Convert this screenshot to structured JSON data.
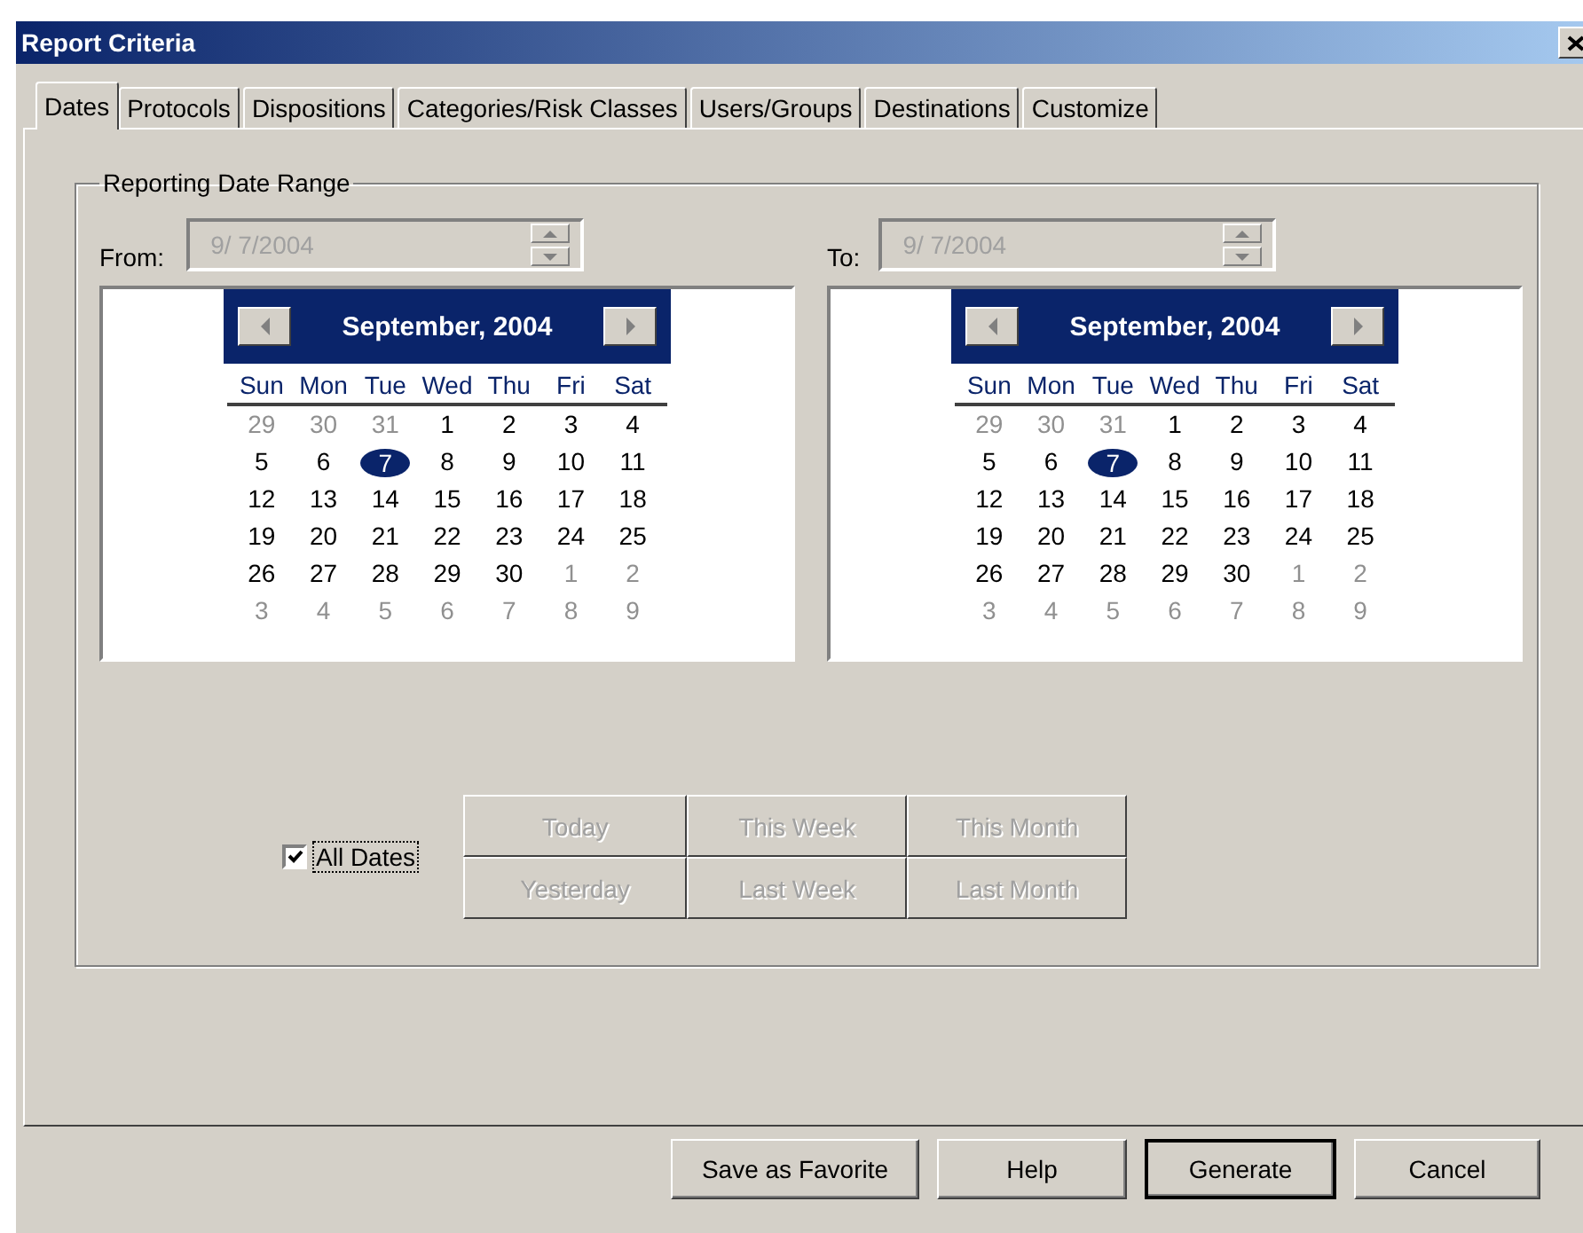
{
  "window": {
    "title": "Report Criteria"
  },
  "tabs": [
    {
      "label": "Dates",
      "selected": true
    },
    {
      "label": "Protocols",
      "selected": false
    },
    {
      "label": "Dispositions",
      "selected": false
    },
    {
      "label": "Categories/Risk Classes",
      "selected": false
    },
    {
      "label": "Users/Groups",
      "selected": false
    },
    {
      "label": "Destinations",
      "selected": false
    },
    {
      "label": "Customize",
      "selected": false
    }
  ],
  "date_range": {
    "title": "Reporting Date Range",
    "pickers": [
      {
        "label": "From:",
        "value": "9/ 7/2004",
        "disabled": true,
        "month": "September, 2004",
        "weekdays": [
          "Sun",
          "Mon",
          "Tue",
          "Wed",
          "Thu",
          "Fri",
          "Sat"
        ],
        "weeks": [
          [
            {
              "day": "29",
              "muted": true,
              "selected": false
            },
            {
              "day": "30",
              "muted": true,
              "selected": false
            },
            {
              "day": "31",
              "muted": true,
              "selected": false
            },
            {
              "day": "1",
              "muted": false,
              "selected": false
            },
            {
              "day": "2",
              "muted": false,
              "selected": false
            },
            {
              "day": "3",
              "muted": false,
              "selected": false
            },
            {
              "day": "4",
              "muted": false,
              "selected": false
            }
          ],
          [
            {
              "day": "5",
              "muted": false,
              "selected": false
            },
            {
              "day": "6",
              "muted": false,
              "selected": false
            },
            {
              "day": "7",
              "muted": false,
              "selected": true
            },
            {
              "day": "8",
              "muted": false,
              "selected": false
            },
            {
              "day": "9",
              "muted": false,
              "selected": false
            },
            {
              "day": "10",
              "muted": false,
              "selected": false
            },
            {
              "day": "11",
              "muted": false,
              "selected": false
            }
          ],
          [
            {
              "day": "12",
              "muted": false,
              "selected": false
            },
            {
              "day": "13",
              "muted": false,
              "selected": false
            },
            {
              "day": "14",
              "muted": false,
              "selected": false
            },
            {
              "day": "15",
              "muted": false,
              "selected": false
            },
            {
              "day": "16",
              "muted": false,
              "selected": false
            },
            {
              "day": "17",
              "muted": false,
              "selected": false
            },
            {
              "day": "18",
              "muted": false,
              "selected": false
            }
          ],
          [
            {
              "day": "19",
              "muted": false,
              "selected": false
            },
            {
              "day": "20",
              "muted": false,
              "selected": false
            },
            {
              "day": "21",
              "muted": false,
              "selected": false
            },
            {
              "day": "22",
              "muted": false,
              "selected": false
            },
            {
              "day": "23",
              "muted": false,
              "selected": false
            },
            {
              "day": "24",
              "muted": false,
              "selected": false
            },
            {
              "day": "25",
              "muted": false,
              "selected": false
            }
          ],
          [
            {
              "day": "26",
              "muted": false,
              "selected": false
            },
            {
              "day": "27",
              "muted": false,
              "selected": false
            },
            {
              "day": "28",
              "muted": false,
              "selected": false
            },
            {
              "day": "29",
              "muted": false,
              "selected": false
            },
            {
              "day": "30",
              "muted": false,
              "selected": false
            },
            {
              "day": "1",
              "muted": true,
              "selected": false
            },
            {
              "day": "2",
              "muted": true,
              "selected": false
            }
          ],
          [
            {
              "day": "3",
              "muted": true,
              "selected": false
            },
            {
              "day": "4",
              "muted": true,
              "selected": false
            },
            {
              "day": "5",
              "muted": true,
              "selected": false
            },
            {
              "day": "6",
              "muted": true,
              "selected": false
            },
            {
              "day": "7",
              "muted": true,
              "selected": false
            },
            {
              "day": "8",
              "muted": true,
              "selected": false
            },
            {
              "day": "9",
              "muted": true,
              "selected": false
            }
          ]
        ]
      },
      {
        "label": "To:",
        "value": "9/ 7/2004",
        "disabled": true,
        "month": "September, 2004",
        "weekdays": [
          "Sun",
          "Mon",
          "Tue",
          "Wed",
          "Thu",
          "Fri",
          "Sat"
        ],
        "weeks": [
          [
            {
              "day": "29",
              "muted": true,
              "selected": false
            },
            {
              "day": "30",
              "muted": true,
              "selected": false
            },
            {
              "day": "31",
              "muted": true,
              "selected": false
            },
            {
              "day": "1",
              "muted": false,
              "selected": false
            },
            {
              "day": "2",
              "muted": false,
              "selected": false
            },
            {
              "day": "3",
              "muted": false,
              "selected": false
            },
            {
              "day": "4",
              "muted": false,
              "selected": false
            }
          ],
          [
            {
              "day": "5",
              "muted": false,
              "selected": false
            },
            {
              "day": "6",
              "muted": false,
              "selected": false
            },
            {
              "day": "7",
              "muted": false,
              "selected": true
            },
            {
              "day": "8",
              "muted": false,
              "selected": false
            },
            {
              "day": "9",
              "muted": false,
              "selected": false
            },
            {
              "day": "10",
              "muted": false,
              "selected": false
            },
            {
              "day": "11",
              "muted": false,
              "selected": false
            }
          ],
          [
            {
              "day": "12",
              "muted": false,
              "selected": false
            },
            {
              "day": "13",
              "muted": false,
              "selected": false
            },
            {
              "day": "14",
              "muted": false,
              "selected": false
            },
            {
              "day": "15",
              "muted": false,
              "selected": false
            },
            {
              "day": "16",
              "muted": false,
              "selected": false
            },
            {
              "day": "17",
              "muted": false,
              "selected": false
            },
            {
              "day": "18",
              "muted": false,
              "selected": false
            }
          ],
          [
            {
              "day": "19",
              "muted": false,
              "selected": false
            },
            {
              "day": "20",
              "muted": false,
              "selected": false
            },
            {
              "day": "21",
              "muted": false,
              "selected": false
            },
            {
              "day": "22",
              "muted": false,
              "selected": false
            },
            {
              "day": "23",
              "muted": false,
              "selected": false
            },
            {
              "day": "24",
              "muted": false,
              "selected": false
            },
            {
              "day": "25",
              "muted": false,
              "selected": false
            }
          ],
          [
            {
              "day": "26",
              "muted": false,
              "selected": false
            },
            {
              "day": "27",
              "muted": false,
              "selected": false
            },
            {
              "day": "28",
              "muted": false,
              "selected": false
            },
            {
              "day": "29",
              "muted": false,
              "selected": false
            },
            {
              "day": "30",
              "muted": false,
              "selected": false
            },
            {
              "day": "1",
              "muted": true,
              "selected": false
            },
            {
              "day": "2",
              "muted": true,
              "selected": false
            }
          ],
          [
            {
              "day": "3",
              "muted": true,
              "selected": false
            },
            {
              "day": "4",
              "muted": true,
              "selected": false
            },
            {
              "day": "5",
              "muted": true,
              "selected": false
            },
            {
              "day": "6",
              "muted": true,
              "selected": false
            },
            {
              "day": "7",
              "muted": true,
              "selected": false
            },
            {
              "day": "8",
              "muted": true,
              "selected": false
            },
            {
              "day": "9",
              "muted": true,
              "selected": false
            }
          ]
        ]
      }
    ],
    "all_dates": {
      "label": "All Dates",
      "checked": true
    },
    "quick_buttons": [
      {
        "label": "Today",
        "disabled": true
      },
      {
        "label": "This Week",
        "disabled": true
      },
      {
        "label": "This Month",
        "disabled": true
      },
      {
        "label": "Yesterday",
        "disabled": true
      },
      {
        "label": "Last Week",
        "disabled": true
      },
      {
        "label": "Last Month",
        "disabled": true
      }
    ]
  },
  "footer_buttons": [
    {
      "label": "Save as Favorite",
      "default": false
    },
    {
      "label": "Help",
      "default": false
    },
    {
      "label": "Generate",
      "default": true
    },
    {
      "label": "Cancel",
      "default": false
    }
  ]
}
